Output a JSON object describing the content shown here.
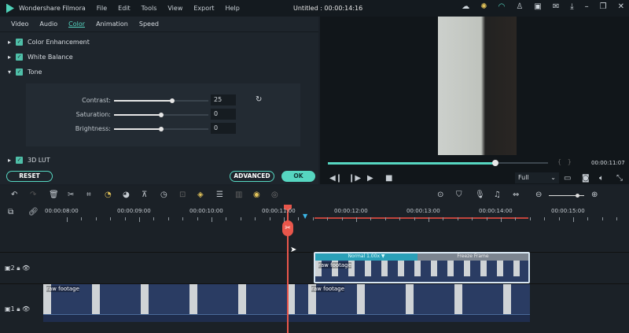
{
  "app": {
    "name": "Wondershare Filmora",
    "menu": [
      "File",
      "Edit",
      "Tools",
      "View",
      "Export",
      "Help"
    ],
    "title": "Untitled : 00:00:14:16"
  },
  "tabs": [
    "Video",
    "Audio",
    "Color",
    "Animation",
    "Speed"
  ],
  "active_tab": "Color",
  "sections": [
    "Color Enhancement",
    "White Balance",
    "Tone",
    "3D LUT"
  ],
  "tone": [
    {
      "label": "Contrast:",
      "value": "25",
      "level": 0.62
    },
    {
      "label": "Saturation:",
      "value": "0",
      "level": 0.5
    },
    {
      "label": "Brightness:",
      "value": "0",
      "level": 0.5
    }
  ],
  "buttons": {
    "reset": "RESET",
    "advanced": "ADVANCED",
    "ok": "OK"
  },
  "player": {
    "progress": 0.76,
    "time": "00:00:11:07",
    "quality": "Full"
  },
  "ruler": [
    "00:00:08:00",
    "00:00:09:00",
    "00:00:10:00",
    "00:00:11:00",
    "00:00:12:00",
    "00:00:13:00",
    "00:00:14:00",
    "00:00:15:00"
  ],
  "clips": {
    "speed": "Normal 1.00x",
    "freeze": "Freeze Frame",
    "name": "raw footage"
  },
  "tracks": [
    "2",
    "1"
  ],
  "accent": "#56d6c1",
  "playhead_color": "#e8564b"
}
